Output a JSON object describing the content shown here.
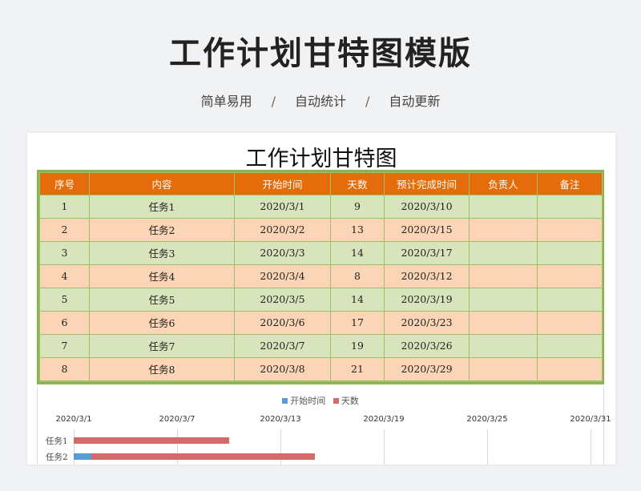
{
  "hero": {
    "title": "工作计划甘特图模版",
    "tags": [
      "简单易用",
      "自动统计",
      "自动更新"
    ],
    "separator": "/"
  },
  "sheet": {
    "title": "工作计划甘特图",
    "headers": [
      "序号",
      "内容",
      "开始时间",
      "天数",
      "预计完成时间",
      "负责人",
      "备注"
    ],
    "rows": [
      [
        "1",
        "任务1",
        "2020/3/1",
        "9",
        "2020/3/10",
        "",
        ""
      ],
      [
        "2",
        "任务2",
        "2020/3/2",
        "13",
        "2020/3/15",
        "",
        ""
      ],
      [
        "3",
        "任务3",
        "2020/3/3",
        "14",
        "2020/3/17",
        "",
        ""
      ],
      [
        "4",
        "任务4",
        "2020/3/4",
        "8",
        "2020/3/12",
        "",
        ""
      ],
      [
        "5",
        "任务5",
        "2020/3/5",
        "14",
        "2020/3/19",
        "",
        ""
      ],
      [
        "6",
        "任务6",
        "2020/3/6",
        "17",
        "2020/3/23",
        "",
        ""
      ],
      [
        "7",
        "任务7",
        "2020/3/7",
        "19",
        "2020/3/26",
        "",
        ""
      ],
      [
        "8",
        "任务8",
        "2020/3/8",
        "21",
        "2020/3/29",
        "",
        ""
      ]
    ]
  },
  "colors": {
    "header": "#e46c0a",
    "row_green": "#d8e4bc",
    "row_orange": "#fbd5b5",
    "frame": "#8cb552",
    "start_series": "#5b9bd5",
    "days_series": "#d36a6a"
  },
  "chart_data": {
    "type": "bar",
    "orientation": "horizontal-stacked",
    "legend": [
      "开始时间",
      "天数"
    ],
    "legend_position": "top",
    "x_ticks": [
      "2020/3/1",
      "2020/3/7",
      "2020/3/13",
      "2020/3/19",
      "2020/3/25",
      "2020/3/31"
    ],
    "xlim": [
      "2020/3/1",
      "2020/3/31"
    ],
    "categories": [
      "任务1",
      "任务2"
    ],
    "series": [
      {
        "name": "开始时间",
        "values": [
          "2020/3/1",
          "2020/3/2"
        ]
      },
      {
        "name": "天数",
        "values": [
          9,
          13
        ]
      }
    ]
  }
}
